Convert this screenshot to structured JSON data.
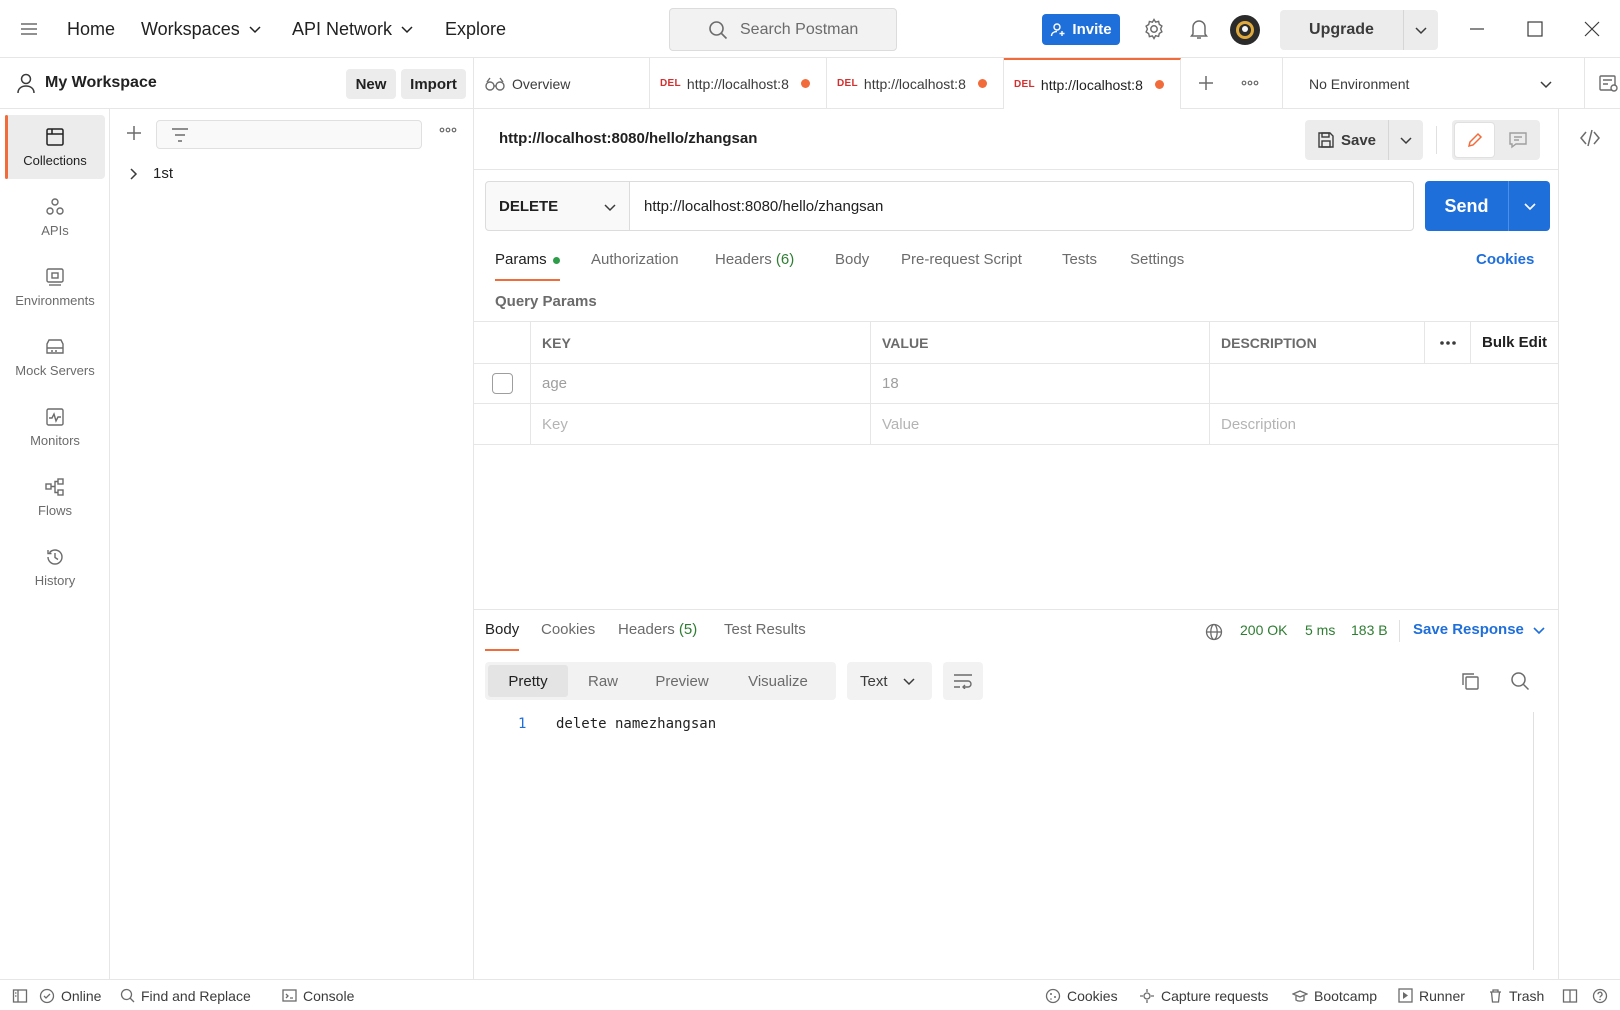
{
  "topbar": {
    "nav": [
      "Home",
      "Workspaces",
      "API Network",
      "Explore"
    ],
    "search_placeholder": "Search Postman",
    "invite_label": "Invite",
    "upgrade_label": "Upgrade"
  },
  "workspace": {
    "name": "My Workspace",
    "new_label": "New",
    "import_label": "Import"
  },
  "rail": {
    "items": [
      {
        "label": "Collections",
        "icon": "collections-icon",
        "active": true
      },
      {
        "label": "APIs",
        "icon": "apis-icon"
      },
      {
        "label": "Environments",
        "icon": "environments-icon"
      },
      {
        "label": "Mock Servers",
        "icon": "mock-servers-icon"
      },
      {
        "label": "Monitors",
        "icon": "monitors-icon"
      },
      {
        "label": "Flows",
        "icon": "flows-icon"
      },
      {
        "label": "History",
        "icon": "history-icon"
      }
    ]
  },
  "collections": {
    "items": [
      {
        "name": "1st"
      }
    ]
  },
  "tabs": {
    "overview_label": "Overview",
    "request_tabs": [
      {
        "method": "DEL",
        "title": "http://localhost:8",
        "unsaved": true,
        "active": false
      },
      {
        "method": "DEL",
        "title": "http://localhost:8",
        "unsaved": true,
        "active": false
      },
      {
        "method": "DEL",
        "title": "http://localhost:8",
        "unsaved": true,
        "active": true
      }
    ],
    "environment": "No Environment"
  },
  "request": {
    "title": "http://localhost:8080/hello/zhangsan",
    "save_label": "Save",
    "method": "DELETE",
    "url": "http://localhost:8080/hello/zhangsan",
    "send_label": "Send",
    "tabs": {
      "params": "Params",
      "authorization": "Authorization",
      "headers": "Headers",
      "headers_count": "(6)",
      "body": "Body",
      "prerequest": "Pre-request Script",
      "tests": "Tests",
      "settings": "Settings"
    },
    "cookies_label": "Cookies",
    "query_params_title": "Query Params",
    "params_table": {
      "headers": {
        "key": "KEY",
        "value": "VALUE",
        "description": "DESCRIPTION",
        "bulk_edit": "Bulk Edit"
      },
      "rows": [
        {
          "key": "age",
          "value": "18",
          "description": "",
          "checked": false
        }
      ],
      "placeholders": {
        "key": "Key",
        "value": "Value",
        "description": "Description"
      }
    }
  },
  "response": {
    "tabs": {
      "body": "Body",
      "cookies": "Cookies",
      "headers": "Headers",
      "headers_count": "(5)",
      "test_results": "Test Results"
    },
    "status": "200 OK",
    "time": "5 ms",
    "size": "183 B",
    "save_response_label": "Save Response",
    "formats": [
      "Pretty",
      "Raw",
      "Preview",
      "Visualize"
    ],
    "active_format": "Pretty",
    "language": "Text",
    "lines": [
      {
        "no": "1",
        "text": "delete namezhangsan"
      }
    ]
  },
  "statusbar": {
    "online": "Online",
    "find_replace": "Find and Replace",
    "console": "Console",
    "cookies": "Cookies",
    "capture": "Capture requests",
    "bootcamp": "Bootcamp",
    "runner": "Runner",
    "trash": "Trash"
  },
  "colors": {
    "accent": "#f26b3a",
    "primary": "#1f6fdb",
    "success": "#2e7d32",
    "delete_method": "#d32f2f"
  }
}
